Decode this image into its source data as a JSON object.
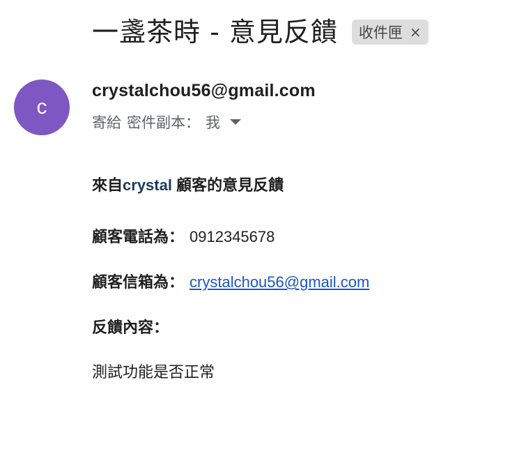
{
  "email": {
    "subject": "一盞茶時 - 意見反饋",
    "label_chip": "收件匣",
    "chip_close": "×",
    "avatar_letter": "c",
    "avatar_color": "#7e57c2",
    "sender": "crystalchou56@gmail.com",
    "recipients": {
      "to_label": "寄給",
      "bcc_label": "密件副本：",
      "recipient": "我"
    }
  },
  "message": {
    "heading_prefix": "來自",
    "heading_brand": "crystal",
    "heading_suffix": " 顧客的意見反饋",
    "phone_label": "顧客電話為：",
    "phone_value": "0912345678",
    "email_label": "顧客信箱為：",
    "email_value": "crystalchou56@gmail.com",
    "feedback_label": "反饋內容：",
    "feedback_text": "測試功能是否正常"
  },
  "colors": {
    "link": "#1a56c9",
    "brand_text": "#1e3a5f",
    "muted": "#5f6368",
    "chip_bg": "#dddddd"
  }
}
